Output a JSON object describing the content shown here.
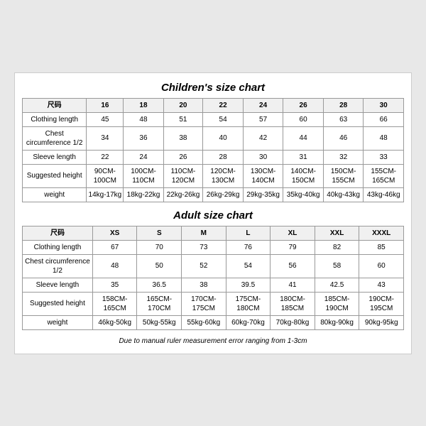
{
  "children_chart": {
    "title": "Children's size chart",
    "columns": [
      "尺码",
      "16",
      "18",
      "20",
      "22",
      "24",
      "26",
      "28",
      "30"
    ],
    "rows": [
      {
        "label": "Clothing length",
        "values": [
          "45",
          "48",
          "51",
          "54",
          "57",
          "60",
          "63",
          "66"
        ]
      },
      {
        "label": "Chest circumference 1/2",
        "values": [
          "34",
          "36",
          "38",
          "40",
          "42",
          "44",
          "46",
          "48"
        ]
      },
      {
        "label": "Sleeve length",
        "values": [
          "22",
          "24",
          "26",
          "28",
          "30",
          "31",
          "32",
          "33"
        ]
      },
      {
        "label": "Suggested height",
        "values": [
          "90CM-100CM",
          "100CM-110CM",
          "110CM-120CM",
          "120CM-130CM",
          "130CM-140CM",
          "140CM-150CM",
          "150CM-155CM",
          "155CM-165CM"
        ]
      },
      {
        "label": "weight",
        "values": [
          "14kg-17kg",
          "18kg-22kg",
          "22kg-26kg",
          "26kg-29kg",
          "29kg-35kg",
          "35kg-40kg",
          "40kg-43kg",
          "43kg-46kg"
        ]
      }
    ]
  },
  "adult_chart": {
    "title": "Adult size chart",
    "columns": [
      "尺码",
      "XS",
      "S",
      "M",
      "L",
      "XL",
      "XXL",
      "XXXL"
    ],
    "rows": [
      {
        "label": "Clothing length",
        "values": [
          "67",
          "70",
          "73",
          "76",
          "79",
          "82",
          "85"
        ]
      },
      {
        "label": "Chest circumference 1/2",
        "values": [
          "48",
          "50",
          "52",
          "54",
          "56",
          "58",
          "60"
        ]
      },
      {
        "label": "Sleeve length",
        "values": [
          "35",
          "36.5",
          "38",
          "39.5",
          "41",
          "42.5",
          "43"
        ]
      },
      {
        "label": "Suggested height",
        "values": [
          "158CM-165CM",
          "165CM-170CM",
          "170CM-175CM",
          "175CM-180CM",
          "180CM-185CM",
          "185CM-190CM",
          "190CM-195CM"
        ]
      },
      {
        "label": "weight",
        "values": [
          "46kg-50kg",
          "50kg-55kg",
          "55kg-60kg",
          "60kg-70kg",
          "70kg-80kg",
          "80kg-90kg",
          "90kg-95kg"
        ]
      }
    ]
  },
  "note": "Due to manual ruler measurement error ranging from 1-3cm"
}
